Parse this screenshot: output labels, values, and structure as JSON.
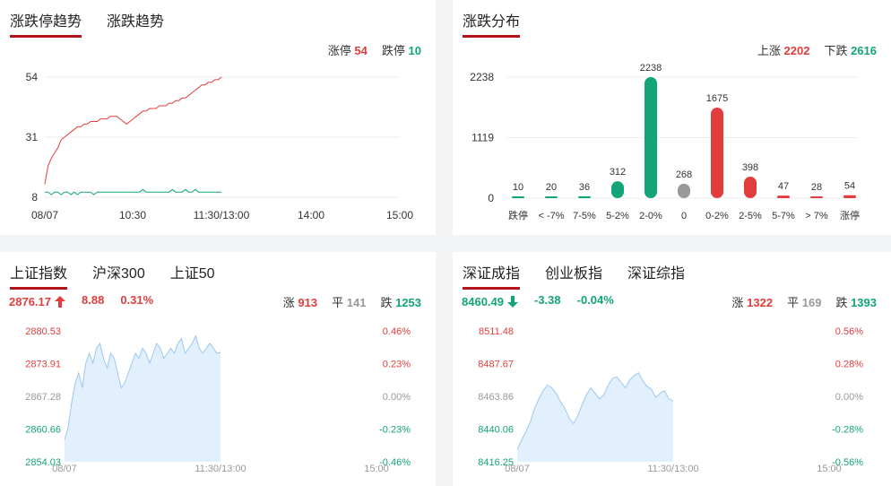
{
  "trend_panel": {
    "tabs": [
      "涨跌停趋势",
      "涨跌趋势"
    ],
    "limit_up_label": "涨停",
    "limit_up_value": "54",
    "limit_down_label": "跌停",
    "limit_down_value": "10"
  },
  "dist_panel": {
    "tabs": [
      "涨跌分布"
    ],
    "up_label": "上涨",
    "up_value": "2202",
    "down_label": "下跌",
    "down_value": "2616"
  },
  "sh_panel": {
    "tabs": [
      "上证指数",
      "沪深300",
      "上证50"
    ],
    "price": "2876.17",
    "change": "8.88",
    "pct": "0.31%",
    "up_label": "涨",
    "up_value": "913",
    "flat_label": "平",
    "flat_value": "141",
    "down_label": "跌",
    "down_value": "1253"
  },
  "sz_panel": {
    "tabs": [
      "深证成指",
      "创业板指",
      "深证综指"
    ],
    "price": "8460.49",
    "change": "-3.38",
    "pct": "-0.04%",
    "up_label": "涨",
    "up_value": "1322",
    "flat_label": "平",
    "flat_value": "169",
    "down_label": "跌",
    "down_value": "1393"
  },
  "colors": {
    "up": "#e23d3d",
    "down": "#13a579",
    "flat": "#999999",
    "accent": "#b3141c",
    "area_fill": "#e2f0fd",
    "area_line": "#9cc8f0"
  },
  "icons": {
    "sh_direction": "arrow-up-icon",
    "sz_direction": "arrow-down-icon"
  },
  "chart_data": [
    {
      "type": "line",
      "x_ticks": [
        "08/07",
        "10:30",
        "11:30/13:00",
        "14:00",
        "15:00"
      ],
      "y_ticks": [
        "54",
        "31",
        "8"
      ],
      "ylim": [
        8,
        54
      ],
      "series": [
        {
          "name": "涨停",
          "values": [
            13,
            20,
            23,
            25,
            27,
            30,
            31,
            32,
            33,
            34,
            35,
            35,
            36,
            36,
            37,
            37,
            37,
            38,
            38,
            38,
            39,
            39,
            39,
            38,
            37,
            36,
            37,
            38,
            39,
            40,
            41,
            41,
            42,
            42,
            42,
            43,
            43,
            43,
            44,
            44,
            45,
            45,
            46,
            46,
            47,
            48,
            49,
            50,
            51,
            51,
            52,
            52,
            53,
            53,
            54
          ]
        },
        {
          "name": "跌停",
          "values": [
            10,
            10,
            9,
            10,
            10,
            9,
            10,
            10,
            9,
            10,
            9,
            10,
            10,
            10,
            10,
            9,
            10,
            10,
            10,
            10,
            10,
            10,
            10,
            10,
            10,
            10,
            10,
            10,
            10,
            10,
            11,
            10,
            10,
            10,
            10,
            10,
            10,
            10,
            10,
            11,
            10,
            10,
            10,
            11,
            10,
            10,
            11,
            10,
            10,
            10,
            10,
            10,
            10,
            10,
            10
          ]
        }
      ]
    },
    {
      "type": "bar",
      "categories": [
        "跌停",
        "< -7%",
        "7-5%",
        "5-2%",
        "2-0%",
        "0",
        "0-2%",
        "2-5%",
        "5-7%",
        "> 7%",
        "涨停"
      ],
      "values": [
        10,
        20,
        36,
        312,
        2238,
        268,
        1675,
        398,
        47,
        28,
        54
      ],
      "bar_colors": [
        "down",
        "down",
        "down",
        "down",
        "down",
        "flat",
        "up",
        "up",
        "up",
        "up",
        "up"
      ],
      "y_ticks": [
        "2238",
        "1119",
        "0"
      ],
      "ylim": [
        0,
        2238
      ]
    },
    {
      "type": "area",
      "x_ticks": [
        "08/07",
        "11:30/13:00",
        "15:00"
      ],
      "y_ticks": [
        "2880.53",
        "2873.91",
        "2867.28",
        "2860.66",
        "2854.03"
      ],
      "pct_ticks": [
        "0.46%",
        "0.23%",
        "0.00%",
        "-0.23%",
        "-0.46%"
      ],
      "ylim": [
        2854.03,
        2880.53
      ],
      "values": [
        2858.5,
        2861.0,
        2866.0,
        2870.0,
        2872.0,
        2869.0,
        2874.0,
        2876.0,
        2874.0,
        2877.0,
        2878.0,
        2875.0,
        2873.0,
        2876.0,
        2875.0,
        2872.0,
        2869.0,
        2870.0,
        2872.0,
        2874.0,
        2876.0,
        2875.0,
        2877.0,
        2876.0,
        2874.0,
        2876.0,
        2878.0,
        2877.0,
        2875.0,
        2876.0,
        2877.0,
        2876.0,
        2878.0,
        2879.0,
        2876.0,
        2877.0,
        2878.0,
        2879.5,
        2877.0,
        2876.0,
        2877.0,
        2878.0,
        2877.0,
        2876.0,
        2876.17
      ]
    },
    {
      "type": "area",
      "x_ticks": [
        "08/07",
        "11:30/13:00",
        "15:00"
      ],
      "y_ticks": [
        "8511.48",
        "8487.67",
        "8463.86",
        "8440.06",
        "8416.25"
      ],
      "pct_ticks": [
        "0.56%",
        "0.28%",
        "0.00%",
        "-0.28%",
        "-0.56%"
      ],
      "ylim": [
        8416.25,
        8511.48
      ],
      "values": [
        8425.0,
        8432.0,
        8438.0,
        8445.0,
        8455.0,
        8462.0,
        8468.0,
        8472.0,
        8470.0,
        8466.0,
        8460.0,
        8455.0,
        8448.0,
        8444.0,
        8450.0,
        8458.0,
        8465.0,
        8470.0,
        8466.0,
        8462.0,
        8465.0,
        8472.0,
        8477.0,
        8478.0,
        8474.0,
        8470.0,
        8476.0,
        8479.0,
        8481.0,
        8475.0,
        8471.0,
        8469.0,
        8463.0,
        8466.0,
        8468.0,
        8462.0,
        8460.49
      ]
    }
  ]
}
